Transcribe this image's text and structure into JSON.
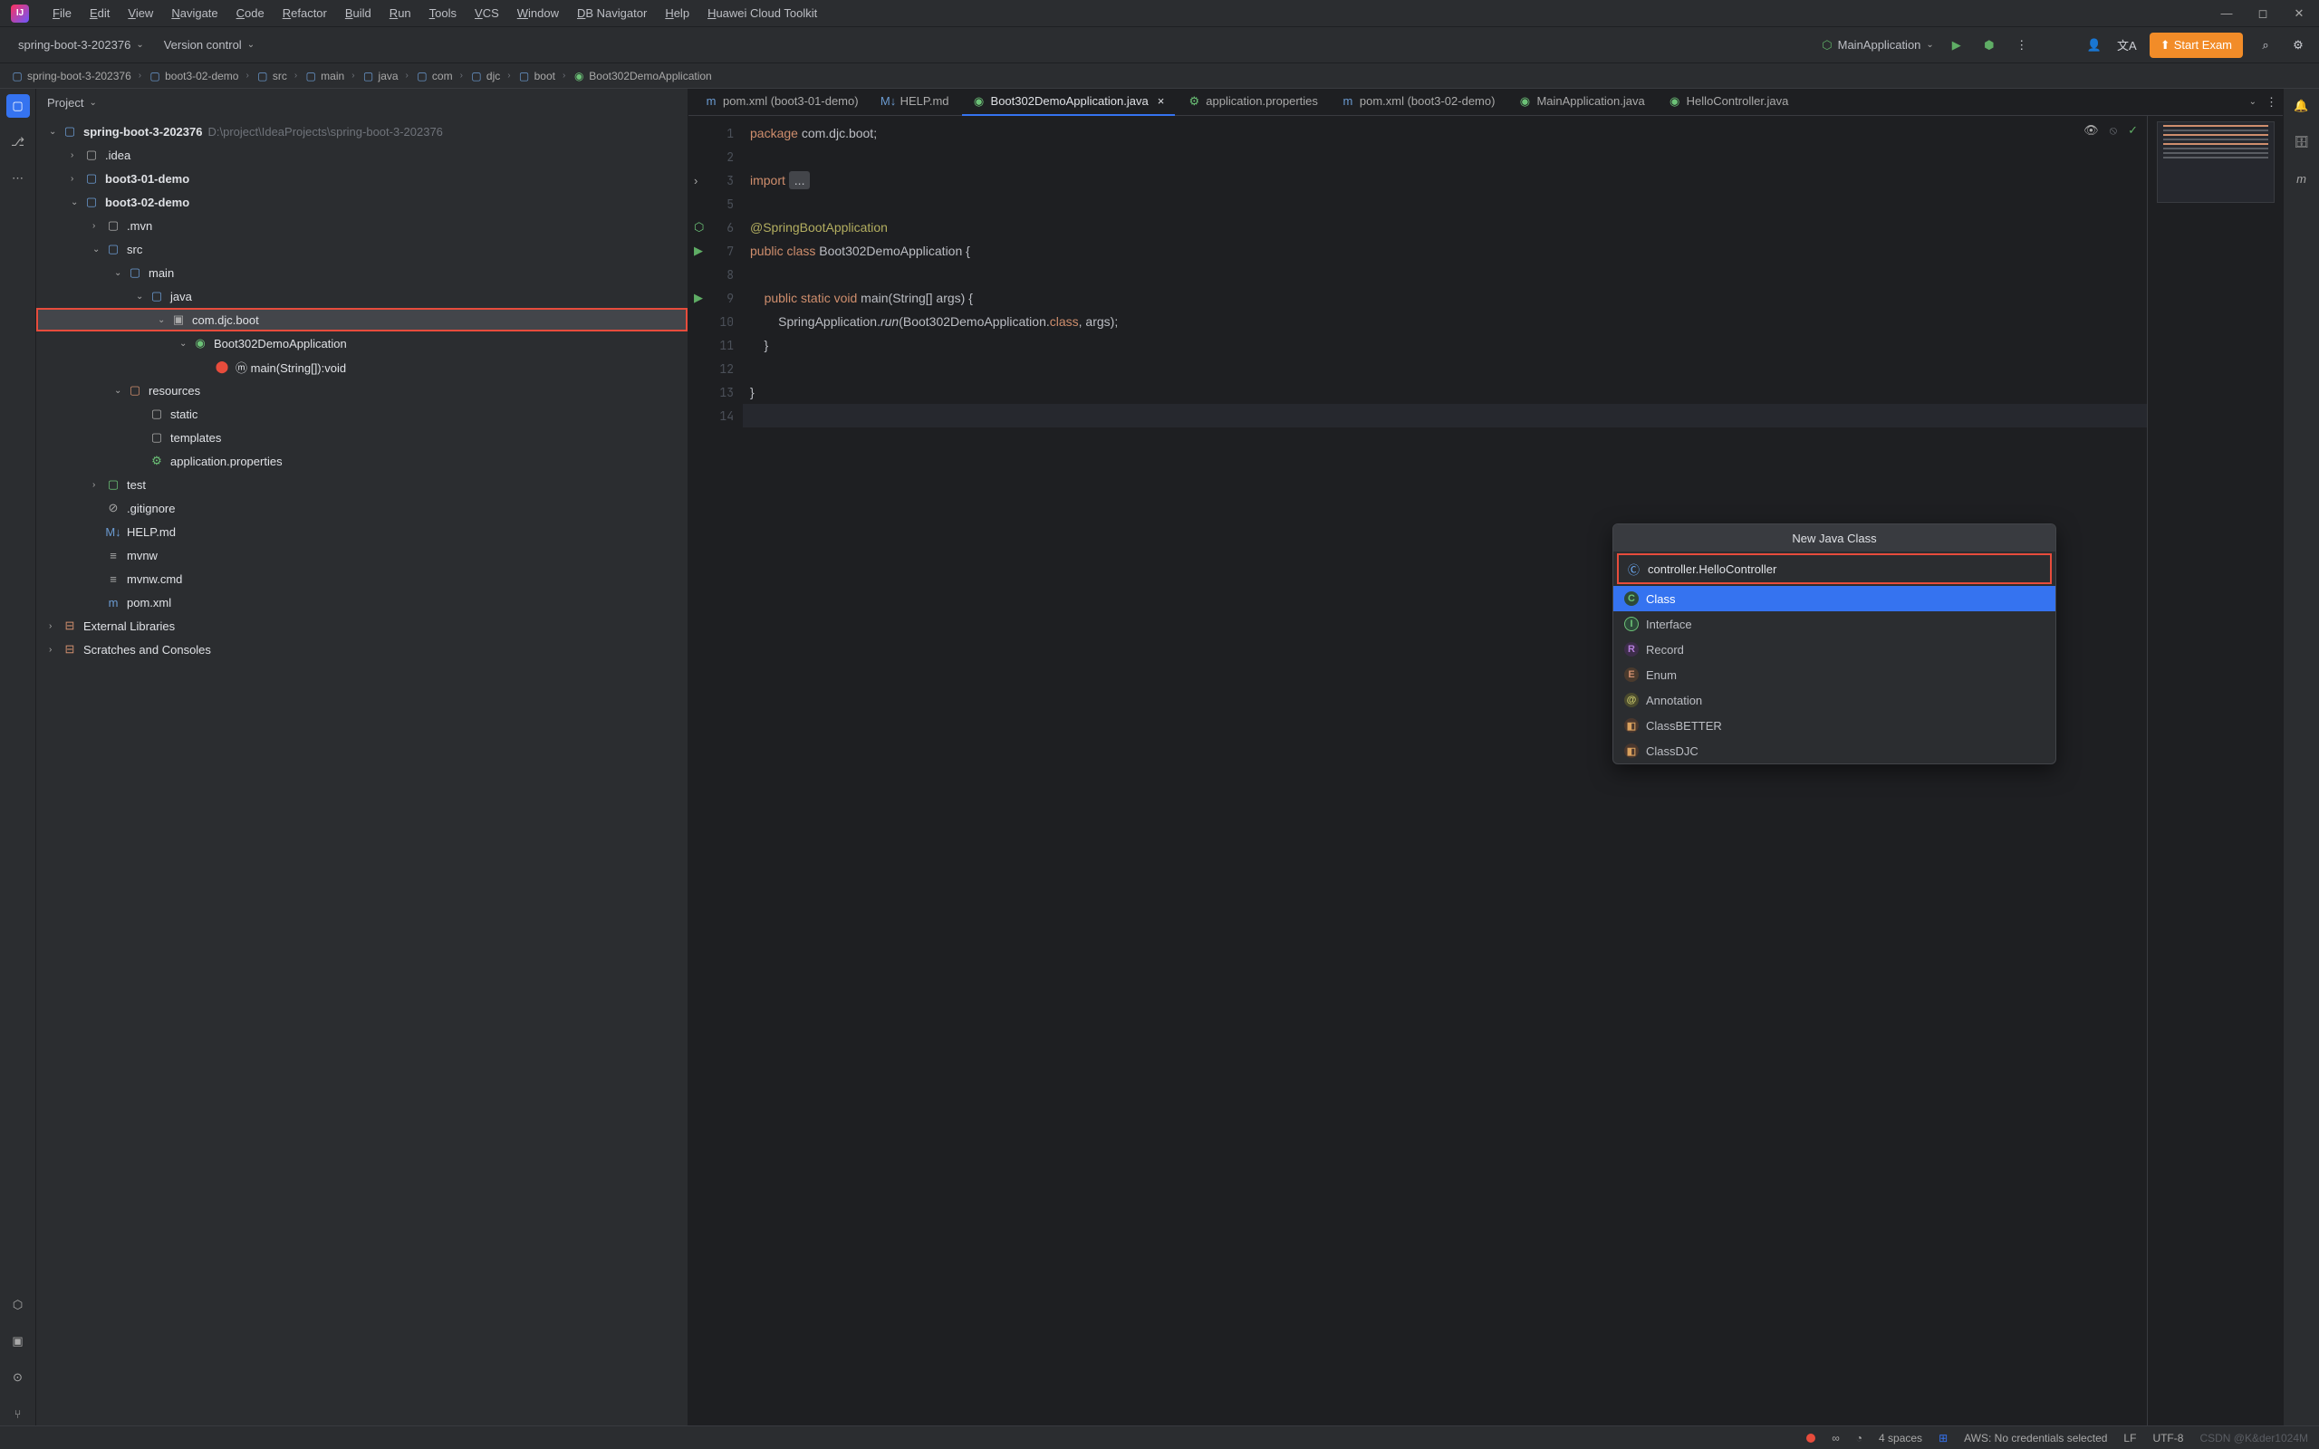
{
  "menubar": {
    "items": [
      "File",
      "Edit",
      "View",
      "Navigate",
      "Code",
      "Refactor",
      "Build",
      "Run",
      "Tools",
      "VCS",
      "Window",
      "DB Navigator",
      "Help",
      "Huawei Cloud Toolkit"
    ]
  },
  "toolbar": {
    "project_name": "spring-boot-3-202376",
    "vcs": "Version control",
    "run_config": "MainApplication",
    "start_exam": "Start Exam"
  },
  "breadcrumbs": [
    "spring-boot-3-202376",
    "boot3-02-demo",
    "src",
    "main",
    "java",
    "com",
    "djc",
    "boot",
    "Boot302DemoApplication"
  ],
  "project": {
    "title": "Project",
    "root": {
      "name": "spring-boot-3-202376",
      "path": "D:\\project\\IdeaProjects\\spring-boot-3-202376"
    },
    "nodes": {
      "idea": ".idea",
      "boot301": "boot3-01-demo",
      "boot302": "boot3-02-demo",
      "mvn": ".mvn",
      "src": "src",
      "main": "main",
      "java": "java",
      "package": "com.djc.boot",
      "app_class": "Boot302DemoApplication",
      "main_method": "main(String[]):void",
      "resources": "resources",
      "static": "static",
      "templates": "templates",
      "app_props": "application.properties",
      "test": "test",
      "gitignore": ".gitignore",
      "help": "HELP.md",
      "mvnw": "mvnw",
      "mvnw_cmd": "mvnw.cmd",
      "pom": "pom.xml",
      "ext_libs": "External Libraries",
      "scratches": "Scratches and Consoles"
    }
  },
  "tabs": [
    {
      "label": "pom.xml (boot3-01-demo)",
      "icon": "m",
      "color": "#6b9bd2"
    },
    {
      "label": "HELP.md",
      "icon": "M↓",
      "color": "#6b9bd2"
    },
    {
      "label": "Boot302DemoApplication.java",
      "icon": "◉",
      "color": "#6cc277",
      "active": true,
      "closeable": true
    },
    {
      "label": "application.properties",
      "icon": "⚙",
      "color": "#6cc277"
    },
    {
      "label": "pom.xml (boot3-02-demo)",
      "icon": "m",
      "color": "#6b9bd2"
    },
    {
      "label": "MainApplication.java",
      "icon": "◉",
      "color": "#6cc277"
    },
    {
      "label": "HelloController.java",
      "icon": "◉",
      "color": "#6cc277"
    }
  ],
  "code": {
    "lines": [
      {
        "n": 1,
        "html": "<span class='kw'>package</span> <span class='pkg'>com.djc.boot;</span>"
      },
      {
        "n": 2,
        "html": ""
      },
      {
        "n": 3,
        "html": "<span class='kw'>import</span> <span class='fold-badge'>...</span>",
        "fold": true
      },
      {
        "n": 5,
        "html": ""
      },
      {
        "n": 6,
        "html": "<span class='ann'>@SpringBootApplication</span>",
        "spring": true
      },
      {
        "n": 7,
        "html": "<span class='kw'>public class</span> <span class='cls'>Boot302DemoApplication</span> {",
        "run": true
      },
      {
        "n": 8,
        "html": ""
      },
      {
        "n": 9,
        "html": "    <span class='kw'>public static void</span> <span class='fn'>main</span>(String[] args) {",
        "run": true
      },
      {
        "n": 10,
        "html": "        SpringApplication.<span class='fn' style='font-style:italic'>run</span>(Boot302DemoApplication.<span class='kw'>class</span>, args);"
      },
      {
        "n": 11,
        "html": "    }"
      },
      {
        "n": 12,
        "html": ""
      },
      {
        "n": 13,
        "html": "}"
      },
      {
        "n": 14,
        "html": "",
        "current": true
      }
    ]
  },
  "popup": {
    "title": "New Java Class",
    "input_value": "controller.HelloController",
    "options": [
      {
        "label": "Class",
        "badge": "C",
        "cls": "badge-C",
        "selected": true
      },
      {
        "label": "Interface",
        "badge": "I",
        "cls": "badge-I"
      },
      {
        "label": "Record",
        "badge": "R",
        "cls": "badge-R"
      },
      {
        "label": "Enum",
        "badge": "E",
        "cls": "badge-E"
      },
      {
        "label": "Annotation",
        "badge": "@",
        "cls": "badge-A"
      },
      {
        "label": "ClassBETTER",
        "badge": "◧",
        "cls": "badge-T"
      },
      {
        "label": "ClassDJC",
        "badge": "◧",
        "cls": "badge-T"
      }
    ]
  },
  "statusbar": {
    "indent": "4 spaces",
    "aws": "AWS: No credentials selected",
    "line_ending": "LF",
    "encoding": "UTF-8",
    "watermark": "CSDN @K&der1024M"
  }
}
